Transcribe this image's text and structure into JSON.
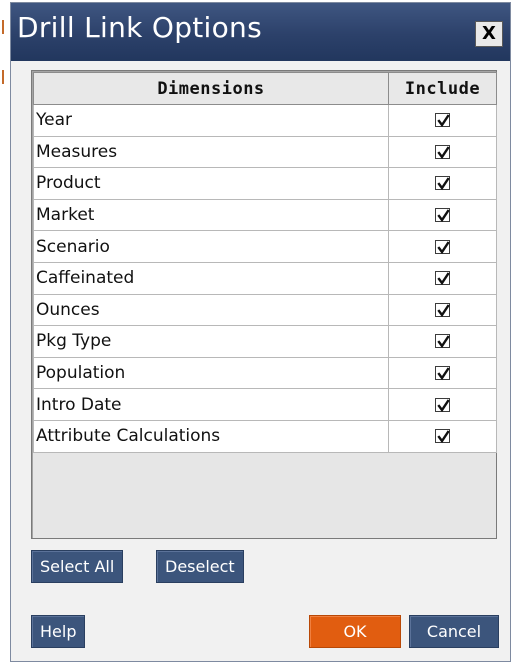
{
  "dialog": {
    "title": "Drill Link Options",
    "close_label": "X"
  },
  "table": {
    "headers": {
      "dimensions": "Dimensions",
      "include": "Include"
    },
    "rows": [
      {
        "name": "Year",
        "include": true
      },
      {
        "name": "Measures",
        "include": true
      },
      {
        "name": "Product",
        "include": true
      },
      {
        "name": "Market",
        "include": true
      },
      {
        "name": "Scenario",
        "include": true
      },
      {
        "name": "Caffeinated",
        "include": true
      },
      {
        "name": "Ounces",
        "include": true
      },
      {
        "name": "Pkg Type",
        "include": true
      },
      {
        "name": "Population",
        "include": true
      },
      {
        "name": "Intro Date",
        "include": true
      },
      {
        "name": "Attribute Calculations",
        "include": true
      }
    ]
  },
  "buttons": {
    "select_all": "Select All",
    "deselect": "Deselect",
    "help": "Help",
    "ok": "OK",
    "cancel": "Cancel"
  },
  "colors": {
    "title_bar": "#2c416a",
    "button": "#3c557c",
    "ok_button": "#e15d10"
  },
  "icons": {
    "close": "close-icon",
    "checkbox": "checkmark-icon"
  }
}
